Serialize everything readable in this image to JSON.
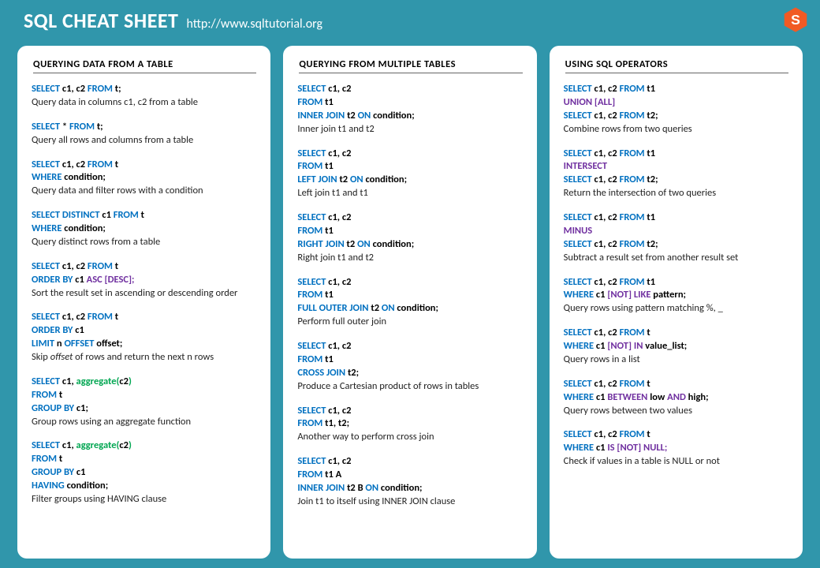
{
  "header": {
    "title": "SQL CHEAT SHEET",
    "url": "http://www.sqltutorial.org"
  },
  "columns": [
    {
      "title": "QUERYING  DATA  FROM  A TABLE",
      "entries": [
        {
          "code": [
            [
              [
                "kw",
                "SELECT"
              ],
              [
                "id",
                " c1, c2 "
              ],
              [
                "kw",
                "FROM"
              ],
              [
                "id",
                " t;"
              ]
            ]
          ],
          "desc": "Query data in columns c1, c2 from a table"
        },
        {
          "code": [
            [
              [
                "kw",
                "SELECT"
              ],
              [
                "id",
                " * "
              ],
              [
                "kw",
                "FROM"
              ],
              [
                "id",
                " t;"
              ]
            ]
          ],
          "desc": "Query all rows and columns  from a table"
        },
        {
          "code": [
            [
              [
                "kw",
                "SELECT"
              ],
              [
                "id",
                " c1, c2 "
              ],
              [
                "kw",
                "FROM"
              ],
              [
                "id",
                " t"
              ]
            ],
            [
              [
                "kw",
                "WHERE"
              ],
              [
                "id",
                " condition;"
              ]
            ]
          ],
          "desc": "Query data and filter rows with a condition"
        },
        {
          "code": [
            [
              [
                "kw",
                "SELECT DISTINCT"
              ],
              [
                "id",
                " c1 "
              ],
              [
                "kw",
                "FROM"
              ],
              [
                "id",
                " t"
              ]
            ],
            [
              [
                "kw",
                "WHERE"
              ],
              [
                "id",
                " condition;"
              ]
            ]
          ],
          "desc": "Query distinct rows from a table"
        },
        {
          "code": [
            [
              [
                "kw",
                "SELECT"
              ],
              [
                "id",
                " c1, c2 "
              ],
              [
                "kw",
                "FROM"
              ],
              [
                "id",
                " t"
              ]
            ],
            [
              [
                "kw",
                "ORDER BY"
              ],
              [
                "id",
                " c1 "
              ],
              [
                "op",
                "ASC [DESC];"
              ]
            ]
          ],
          "desc": "Sort the result set in ascending or descending order"
        },
        {
          "code": [
            [
              [
                "kw",
                "SELECT"
              ],
              [
                "id",
                " c1, c2 "
              ],
              [
                "kw",
                "FROM"
              ],
              [
                "id",
                " t"
              ]
            ],
            [
              [
                "kw",
                "ORDER BY"
              ],
              [
                "id",
                " c1"
              ]
            ],
            [
              [
                "kw",
                "LIMIT"
              ],
              [
                "id",
                " n "
              ],
              [
                "kw",
                "OFFSET"
              ],
              [
                "id",
                " offset;"
              ]
            ]
          ],
          "desc": "Skip <i>offset</i> of rows and return the next n rows"
        },
        {
          "code": [
            [
              [
                "kw",
                "SELECT"
              ],
              [
                "id",
                " c1, "
              ],
              [
                "fn",
                "aggregate("
              ],
              [
                "id",
                "c2"
              ],
              [
                "fn",
                ")"
              ]
            ],
            [
              [
                "kw",
                "FROM"
              ],
              [
                "id",
                " t"
              ]
            ],
            [
              [
                "kw",
                "GROUP BY"
              ],
              [
                "id",
                " c1;"
              ]
            ]
          ],
          "desc": "Group rows using an aggregate function"
        },
        {
          "code": [
            [
              [
                "kw",
                "SELECT"
              ],
              [
                "id",
                " c1, "
              ],
              [
                "fn",
                "aggregate("
              ],
              [
                "id",
                "c2"
              ],
              [
                "fn",
                ")"
              ]
            ],
            [
              [
                "kw",
                "FROM"
              ],
              [
                "id",
                " t"
              ]
            ],
            [
              [
                "kw",
                "GROUP BY"
              ],
              [
                "id",
                " c1"
              ]
            ],
            [
              [
                "kw",
                "HAVING"
              ],
              [
                "id",
                " condition;"
              ]
            ]
          ],
          "desc": "Filter groups using HAVING clause"
        }
      ]
    },
    {
      "title": "QUERYING  FROM  MULTIPLE  TABLES",
      "entries": [
        {
          "code": [
            [
              [
                "kw",
                "SELECT"
              ],
              [
                "id",
                " c1, c2"
              ]
            ],
            [
              [
                "kw",
                "FROM"
              ],
              [
                "id",
                " t1"
              ]
            ],
            [
              [
                "kw",
                "INNER JOIN"
              ],
              [
                "id",
                " t2 "
              ],
              [
                "kw",
                "ON"
              ],
              [
                "id",
                " condition;"
              ]
            ]
          ],
          "desc": "Inner join t1 and t2"
        },
        {
          "code": [
            [
              [
                "kw",
                "SELECT"
              ],
              [
                "id",
                " c1, c2"
              ]
            ],
            [
              [
                "kw",
                "FROM"
              ],
              [
                "id",
                " t1"
              ]
            ],
            [
              [
                "kw",
                "LEFT JOIN"
              ],
              [
                "id",
                " t2 "
              ],
              [
                "kw",
                "ON"
              ],
              [
                "id",
                " condition;"
              ]
            ]
          ],
          "desc": "Left join t1 and t1"
        },
        {
          "code": [
            [
              [
                "kw",
                "SELECT"
              ],
              [
                "id",
                " c1, c2"
              ]
            ],
            [
              [
                "kw",
                "FROM"
              ],
              [
                "id",
                " t1"
              ]
            ],
            [
              [
                "kw",
                "RIGHT JOIN"
              ],
              [
                "id",
                " t2 "
              ],
              [
                "kw",
                "ON"
              ],
              [
                "id",
                " condition;"
              ]
            ]
          ],
          "desc": "Right join t1 and t2"
        },
        {
          "code": [
            [
              [
                "kw",
                "SELECT"
              ],
              [
                "id",
                " c1, c2"
              ]
            ],
            [
              [
                "kw",
                "FROM"
              ],
              [
                "id",
                " t1"
              ]
            ],
            [
              [
                "kw",
                "FULL OUTER JOIN"
              ],
              [
                "id",
                " t2 "
              ],
              [
                "kw",
                "ON"
              ],
              [
                "id",
                " condition;"
              ]
            ]
          ],
          "desc": "Perform full outer join"
        },
        {
          "code": [
            [
              [
                "kw",
                "SELECT"
              ],
              [
                "id",
                " c1, c2"
              ]
            ],
            [
              [
                "kw",
                "FROM"
              ],
              [
                "id",
                " t1"
              ]
            ],
            [
              [
                "kw",
                "CROSS JOIN"
              ],
              [
                "id",
                " t2;"
              ]
            ]
          ],
          "desc": "Produce a Cartesian product of rows in tables"
        },
        {
          "code": [
            [
              [
                "kw",
                "SELECT"
              ],
              [
                "id",
                " c1, c2"
              ]
            ],
            [
              [
                "kw",
                "FROM"
              ],
              [
                "id",
                " t1, t2"
              ],
              [
                "id",
                ";"
              ]
            ]
          ],
          "desc": "Another way to perform cross join"
        },
        {
          "code": [
            [
              [
                "kw",
                "SELECT"
              ],
              [
                "id",
                " c1, c2"
              ]
            ],
            [
              [
                "kw",
                "FROM"
              ],
              [
                "id",
                " t1 A"
              ]
            ],
            [
              [
                "kw",
                "INNER JOIN"
              ],
              [
                "id",
                " t2 B "
              ],
              [
                "kw",
                "ON"
              ],
              [
                "id",
                " condition;"
              ]
            ]
          ],
          "desc": "Join t1 to itself using INNER JOIN clause"
        }
      ]
    },
    {
      "title": "USING  SQL OPERATORS",
      "entries": [
        {
          "code": [
            [
              [
                "kw",
                "SELECT"
              ],
              [
                "id",
                " c1, c2 "
              ],
              [
                "kw",
                "FROM"
              ],
              [
                "id",
                " t1"
              ]
            ],
            [
              [
                "op",
                "UNION  [ALL]"
              ]
            ],
            [
              [
                "kw",
                "SELECT"
              ],
              [
                "id",
                " c1, c2 "
              ],
              [
                "kw",
                "FROM"
              ],
              [
                "id",
                " t2;"
              ]
            ]
          ],
          "desc": "Combine rows from two queries"
        },
        {
          "code": [
            [
              [
                "kw",
                "SELECT"
              ],
              [
                "id",
                " c1, c2 "
              ],
              [
                "kw",
                "FROM"
              ],
              [
                "id",
                " t1"
              ]
            ],
            [
              [
                "op",
                "INTERSECT"
              ]
            ],
            [
              [
                "kw",
                "SELECT"
              ],
              [
                "id",
                " c1, c2 "
              ],
              [
                "kw",
                "FROM"
              ],
              [
                "id",
                " t2;"
              ]
            ]
          ],
          "desc": "Return the intersection of two queries"
        },
        {
          "code": [
            [
              [
                "kw",
                "SELECT"
              ],
              [
                "id",
                " c1, c2 "
              ],
              [
                "kw",
                "FROM"
              ],
              [
                "id",
                " t1"
              ]
            ],
            [
              [
                "op",
                "MINUS"
              ]
            ],
            [
              [
                "kw",
                "SELECT"
              ],
              [
                "id",
                " c1, c2 "
              ],
              [
                "kw",
                "FROM"
              ],
              [
                "id",
                " t2;"
              ]
            ]
          ],
          "desc": "Subtract a result set from another result set"
        },
        {
          "code": [
            [
              [
                "kw",
                "SELECT"
              ],
              [
                "id",
                " c1, c2 "
              ],
              [
                "kw",
                "FROM"
              ],
              [
                "id",
                " t1"
              ]
            ],
            [
              [
                "kw",
                "WHERE"
              ],
              [
                "id",
                " c1 "
              ],
              [
                "op",
                "[NOT] LIKE"
              ],
              [
                "id",
                " pattern;"
              ]
            ]
          ],
          "desc": "Query rows using pattern matching %, _"
        },
        {
          "code": [
            [
              [
                "kw",
                "SELECT"
              ],
              [
                "id",
                " c1, c2 "
              ],
              [
                "kw",
                "FROM"
              ],
              [
                "id",
                " t"
              ]
            ],
            [
              [
                "kw",
                "WHERE"
              ],
              [
                "id",
                " c1 "
              ],
              [
                "op",
                "[NOT] IN"
              ],
              [
                "id",
                " value_list;"
              ]
            ]
          ],
          "desc": "Query rows in a list"
        },
        {
          "code": [
            [
              [
                "kw",
                "SELECT"
              ],
              [
                "id",
                " c1, c2 "
              ],
              [
                "kw",
                "FROM"
              ],
              [
                "id",
                " t"
              ]
            ],
            [
              [
                "kw",
                "WHERE "
              ],
              [
                "id",
                " c1 "
              ],
              [
                "op",
                "BETWEEN"
              ],
              [
                "id",
                " low "
              ],
              [
                "op",
                "AND"
              ],
              [
                "id",
                " high;"
              ]
            ]
          ],
          "desc": "Query rows between two values"
        },
        {
          "code": [
            [
              [
                "kw",
                "SELECT"
              ],
              [
                "id",
                " c1, c2 "
              ],
              [
                "kw",
                "FROM"
              ],
              [
                "id",
                " t"
              ]
            ],
            [
              [
                "kw",
                "WHERE "
              ],
              [
                "id",
                " c1 "
              ],
              [
                "op",
                "IS [NOT] NULL;"
              ]
            ]
          ],
          "desc": "Check if values in a table is NULL or not"
        }
      ]
    }
  ]
}
